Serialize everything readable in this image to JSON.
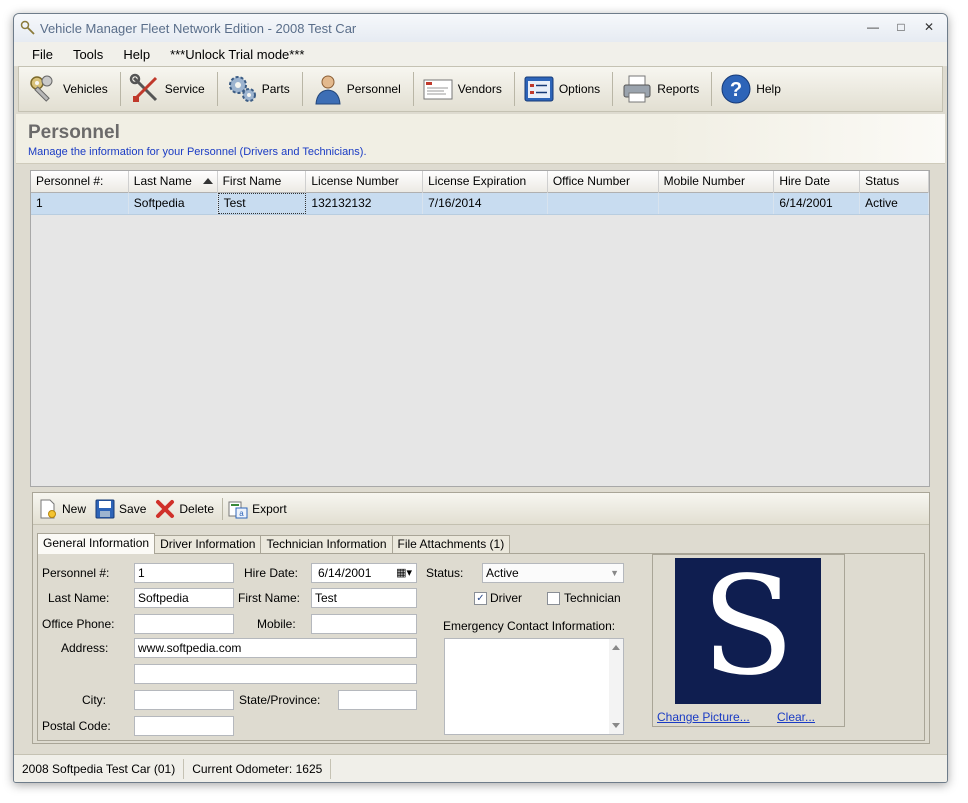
{
  "window": {
    "title": "Vehicle Manager Fleet Network Edition - 2008 Test Car"
  },
  "menu": [
    "File",
    "Tools",
    "Help",
    "***Unlock Trial mode***"
  ],
  "toolbar": [
    {
      "label": "Vehicles",
      "icon": "keys-icon"
    },
    {
      "label": "Service",
      "icon": "wrench-screwdriver-icon"
    },
    {
      "label": "Parts",
      "icon": "gears-icon"
    },
    {
      "label": "Personnel",
      "icon": "person-icon"
    },
    {
      "label": "Vendors",
      "icon": "vendors-icon"
    },
    {
      "label": "Options",
      "icon": "options-icon"
    },
    {
      "label": "Reports",
      "icon": "printer-icon"
    },
    {
      "label": "Help",
      "icon": "help-icon"
    }
  ],
  "header": {
    "title": "Personnel",
    "subtitle": "Manage the information for your Personnel (Drivers and Technicians)."
  },
  "grid": {
    "columns": [
      "Personnel #:",
      "Last Name",
      "First Name",
      "License Number",
      "License Expiration",
      "Office Number",
      "Mobile Number",
      "Hire Date",
      "Status"
    ],
    "rows": [
      [
        "1",
        "Softpedia",
        "Test",
        "132132132",
        "7/16/2014",
        "",
        "",
        "6/14/2001",
        "Active"
      ]
    ]
  },
  "detail_toolbar": {
    "new": "New",
    "save": "Save",
    "delete": "Delete",
    "export": "Export"
  },
  "tabs": [
    "General Information",
    "Driver Information",
    "Technician Information",
    "File Attachments (1)"
  ],
  "form": {
    "personnel_label": "Personnel #:",
    "personnel_value": "1",
    "hire_date_label": "Hire Date:",
    "hire_date_value": "6/14/2001",
    "status_label": "Status:",
    "status_value": "Active",
    "last_name_label": "Last Name:",
    "last_name_value": "Softpedia",
    "first_name_label": "First Name:",
    "first_name_value": "Test",
    "driver_label": "Driver",
    "driver_checked": true,
    "technician_label": "Technician",
    "technician_checked": false,
    "office_phone_label": "Office Phone:",
    "office_phone_value": "",
    "mobile_label": "Mobile:",
    "mobile_value": "",
    "emergency_label": "Emergency Contact Information:",
    "address_label": "Address:",
    "address_line1": "www.softpedia.com",
    "address_line2": "",
    "city_label": "City:",
    "city_value": "",
    "state_label": "State/Province:",
    "state_value": "",
    "postal_label": "Postal Code:",
    "postal_value": "",
    "change_picture": "Change Picture...",
    "clear": "Clear..."
  },
  "status_bar": {
    "vehicle": "2008 Softpedia Test Car (01)",
    "odometer": "Current Odometer: 1625"
  }
}
